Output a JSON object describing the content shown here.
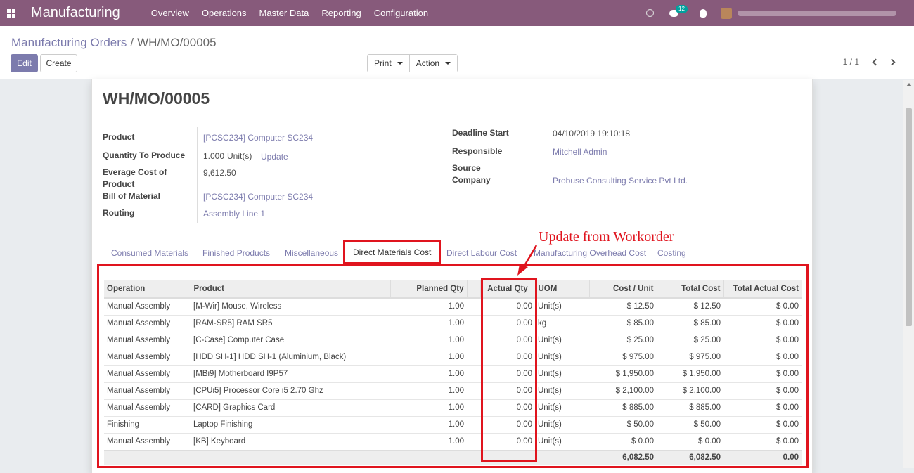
{
  "navbar": {
    "app_name": "Manufacturing",
    "menu": [
      "Overview",
      "Operations",
      "Master Data",
      "Reporting",
      "Configuration"
    ],
    "chat_count": "12",
    "accent": "#875a7b"
  },
  "breadcrumb": {
    "parent": "Manufacturing Orders",
    "separator": "/",
    "current": "WH/MO/00005"
  },
  "buttons": {
    "edit": "Edit",
    "create": "Create",
    "print": "Print",
    "action": "Action"
  },
  "pager": {
    "value": "1 / 1"
  },
  "record": {
    "name": "WH/MO/00005",
    "left_fields": {
      "product_label": "Product",
      "product_value": "[PCSC234] Computer SC234",
      "qty_label": "Quantity To Produce",
      "qty_value": "1.000",
      "qty_uom": "Unit(s)",
      "qty_update": "Update",
      "avg_cost_label": "Everage Cost of Product",
      "avg_cost_value": "9,612.50",
      "bom_label": "Bill of Material",
      "bom_value": "[PCSC234] Computer SC234",
      "routing_label": "Routing",
      "routing_value": "Assembly Line 1"
    },
    "right_fields": {
      "deadline_label": "Deadline Start",
      "deadline_value": "04/10/2019 19:10:18",
      "responsible_label": "Responsible",
      "responsible_value": "Mitchell Admin",
      "source_company_label": "Source Company",
      "source_company_value": "Probuse Consulting Service Pvt Ltd."
    }
  },
  "annotation": {
    "text": "Update from Workorder",
    "color": "#e0141e"
  },
  "tabs": [
    "Consumed Materials",
    "Finished Products",
    "Miscellaneous",
    "Direct Materials Cost",
    "Direct Labour Cost",
    "Manufacturing Overhead Cost",
    "Costing"
  ],
  "active_tab": "Direct Materials Cost",
  "table": {
    "headers": [
      "Operation",
      "Product",
      "Planned Qty",
      "Actual Qty",
      "UOM",
      "Cost / Unit",
      "Total Cost",
      "Total Actual Cost"
    ],
    "rows": [
      [
        "Manual Assembly",
        "[M-Wir] Mouse, Wireless",
        "1.00",
        "0.00",
        "Unit(s)",
        "$ 12.50",
        "$ 12.50",
        "$ 0.00"
      ],
      [
        "Manual Assembly",
        "[RAM-SR5] RAM SR5",
        "1.00",
        "0.00",
        "kg",
        "$ 85.00",
        "$ 85.00",
        "$ 0.00"
      ],
      [
        "Manual Assembly",
        "[C-Case] Computer Case",
        "1.00",
        "0.00",
        "Unit(s)",
        "$ 25.00",
        "$ 25.00",
        "$ 0.00"
      ],
      [
        "Manual Assembly",
        "[HDD SH-1] HDD SH-1 (Aluminium, Black)",
        "1.00",
        "0.00",
        "Unit(s)",
        "$ 975.00",
        "$ 975.00",
        "$ 0.00"
      ],
      [
        "Manual Assembly",
        "[MBi9] Motherboard I9P57",
        "1.00",
        "0.00",
        "Unit(s)",
        "$ 1,950.00",
        "$ 1,950.00",
        "$ 0.00"
      ],
      [
        "Manual Assembly",
        "[CPUi5] Processor Core i5 2.70 Ghz",
        "1.00",
        "0.00",
        "Unit(s)",
        "$ 2,100.00",
        "$ 2,100.00",
        "$ 0.00"
      ],
      [
        "Manual Assembly",
        "[CARD] Graphics Card",
        "1.00",
        "0.00",
        "Unit(s)",
        "$ 885.00",
        "$ 885.00",
        "$ 0.00"
      ],
      [
        "Finishing",
        "Laptop Finishing",
        "1.00",
        "0.00",
        "Unit(s)",
        "$ 50.00",
        "$ 50.00",
        "$ 0.00"
      ],
      [
        "Manual Assembly",
        "[KB] Keyboard",
        "1.00",
        "0.00",
        "Unit(s)",
        "$ 0.00",
        "$ 0.00",
        "$ 0.00"
      ]
    ],
    "footer": {
      "cost_unit_total": "6,082.50",
      "total_cost": "6,082.50",
      "total_actual_cost": "0.00"
    }
  }
}
